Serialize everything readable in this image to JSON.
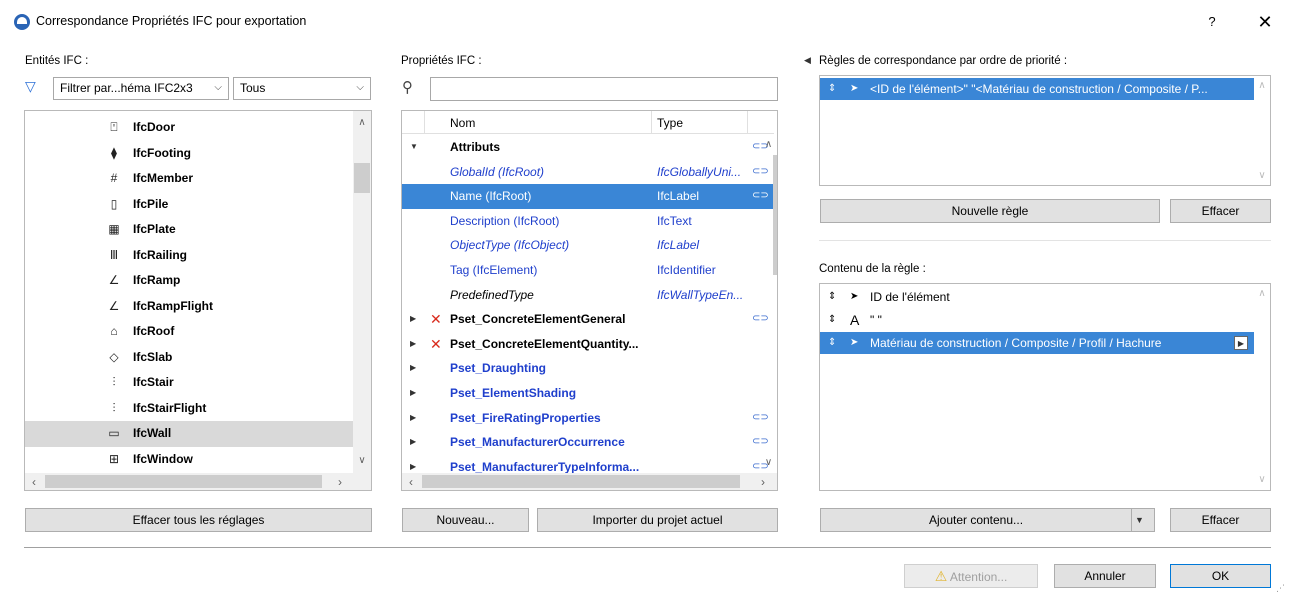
{
  "window": {
    "title": "Correspondance Propriétés IFC pour exportation",
    "help": "?",
    "close": "✕"
  },
  "left": {
    "label": "Entités IFC :",
    "filter_value": "Filtrer par...héma IFC2x3",
    "filter_option": "Tous",
    "items": [
      {
        "label": "IfcDoor",
        "icon": "door-icon",
        "glyph": "⍞"
      },
      {
        "label": "IfcFooting",
        "icon": "footing-icon",
        "glyph": "⧫"
      },
      {
        "label": "IfcMember",
        "icon": "member-icon",
        "glyph": "#"
      },
      {
        "label": "IfcPile",
        "icon": "pile-icon",
        "glyph": "▯"
      },
      {
        "label": "IfcPlate",
        "icon": "plate-icon",
        "glyph": "▦"
      },
      {
        "label": "IfcRailing",
        "icon": "railing-icon",
        "glyph": "Ⅲ"
      },
      {
        "label": "IfcRamp",
        "icon": "ramp-icon",
        "glyph": "∠"
      },
      {
        "label": "IfcRampFlight",
        "icon": "ramp-flight-icon",
        "glyph": "∠"
      },
      {
        "label": "IfcRoof",
        "icon": "roof-icon",
        "glyph": "⌂"
      },
      {
        "label": "IfcSlab",
        "icon": "slab-icon",
        "glyph": "◇"
      },
      {
        "label": "IfcStair",
        "icon": "stair-icon",
        "glyph": "⫶"
      },
      {
        "label": "IfcStairFlight",
        "icon": "stair-flight-icon",
        "glyph": "⫶"
      },
      {
        "label": "IfcWall",
        "icon": "wall-icon",
        "glyph": "▭",
        "selected": true
      },
      {
        "label": "IfcWindow",
        "icon": "window-icon",
        "glyph": "⊞"
      }
    ],
    "clear_all_button": "Effacer tous les réglages"
  },
  "middle": {
    "label": "Propriétés IFC :",
    "search_value": "",
    "columns": {
      "name": "Nom",
      "type": "Type"
    },
    "rows": [
      {
        "name": "Attributs",
        "type": "",
        "style": "bold",
        "exp": "▼",
        "link": true
      },
      {
        "name": "GlobalId (IfcRoot)",
        "type": "IfcGloballyUni...",
        "style": "blue italic",
        "link": true
      },
      {
        "name": "Name (IfcRoot)",
        "type": "IfcLabel",
        "style": "sel",
        "link": true
      },
      {
        "name": "Description (IfcRoot)",
        "type": "IfcText",
        "style": "blue"
      },
      {
        "name": "ObjectType (IfcObject)",
        "type": "IfcLabel",
        "style": "blue italic"
      },
      {
        "name": "Tag (IfcElement)",
        "type": "IfcIdentifier",
        "style": "blue"
      },
      {
        "name": "PredefinedType",
        "type": "IfcWallTypeEn...",
        "style": "italic"
      },
      {
        "name": "Pset_ConcreteElementGeneral",
        "type": "",
        "style": "bold",
        "exp": "▶",
        "x": true,
        "link": true
      },
      {
        "name": "Pset_ConcreteElementQuantity...",
        "type": "",
        "style": "bold",
        "exp": "▶",
        "x": true
      },
      {
        "name": "Pset_Draughting",
        "type": "",
        "style": "bold blue",
        "exp": "▶"
      },
      {
        "name": "Pset_ElementShading",
        "type": "",
        "style": "bold blue",
        "exp": "▶"
      },
      {
        "name": "Pset_FireRatingProperties",
        "type": "",
        "style": "bold blue",
        "exp": "▶",
        "link": true
      },
      {
        "name": "Pset_ManufacturerOccurrence",
        "type": "",
        "style": "bold blue",
        "exp": "▶",
        "link": true
      },
      {
        "name": "Pset_ManufacturerTypeInforma...",
        "type": "",
        "style": "bold blue",
        "exp": "▶",
        "link": true
      }
    ],
    "new_button": "Nouveau...",
    "import_button": "Importer du projet actuel"
  },
  "right": {
    "rules_label": "Règles de correspondance par ordre de priorité :",
    "rules": [
      "<ID de l'élément>\" \"<Matériau de construction / Composite / P..."
    ],
    "new_rule_button": "Nouvelle règle",
    "clear_rule_button": "Effacer",
    "content_label": "Contenu de la règle :",
    "content_items": [
      {
        "label": "ID de l'élément",
        "icon": "pointer-icon",
        "glyph": "➤"
      },
      {
        "label": "\" \"",
        "icon": "text-a-icon",
        "glyph": "A"
      },
      {
        "label": "Matériau de construction / Composite / Profil / Hachure",
        "icon": "pointer-icon",
        "glyph": "➤",
        "selected": true
      }
    ],
    "add_content_button": "Ajouter contenu...",
    "clear_content_button": "Effacer"
  },
  "footer": {
    "warning_button": "Attention...",
    "cancel_button": "Annuler",
    "ok_button": "OK"
  },
  "colors": {
    "selection": "#3a86d6",
    "blue_text": "#1f3fcc",
    "error_x": "#d92a1c"
  }
}
